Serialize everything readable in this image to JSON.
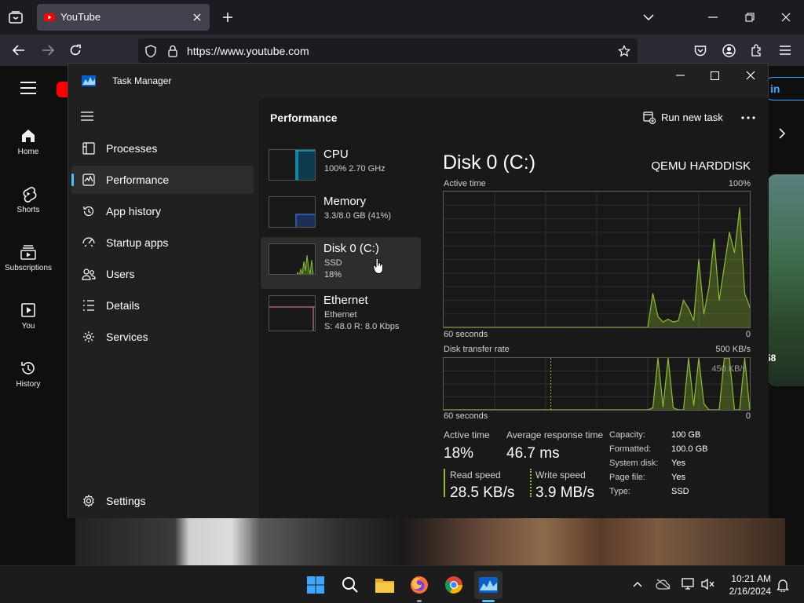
{
  "browser": {
    "tab_title": "YouTube",
    "url": "https://www.youtube.com"
  },
  "youtube": {
    "nav": [
      {
        "label": "Home"
      },
      {
        "label": "Shorts"
      },
      {
        "label": "Subscriptions"
      },
      {
        "label": "You"
      },
      {
        "label": "History"
      }
    ],
    "signin_label": "in",
    "thumb_badge": "58"
  },
  "task_manager": {
    "title": "Task Manager",
    "nav": [
      {
        "label": "Processes",
        "icon": "processes-icon"
      },
      {
        "label": "Performance",
        "icon": "performance-icon",
        "selected": true
      },
      {
        "label": "App history",
        "icon": "app-history-icon"
      },
      {
        "label": "Startup apps",
        "icon": "startup-apps-icon"
      },
      {
        "label": "Users",
        "icon": "users-icon"
      },
      {
        "label": "Details",
        "icon": "details-icon"
      },
      {
        "label": "Services",
        "icon": "services-icon"
      }
    ],
    "settings_label": "Settings",
    "page_title": "Performance",
    "run_new_task_label": "Run new task",
    "resources": [
      {
        "name": "CPU",
        "line1": "100% 2.70 GHz",
        "line2": "",
        "color": "#11a2c3"
      },
      {
        "name": "Memory",
        "line1": "3.3/8.0 GB (41%)",
        "line2": "",
        "color": "#3a68c8"
      },
      {
        "name": "Disk 0 (C:)",
        "line1": "SSD",
        "line2": "18%",
        "color": "#8fbd2e",
        "selected": true
      },
      {
        "name": "Ethernet",
        "line1": "Ethernet",
        "line2": "S: 48.0  R: 8.0 Kbps",
        "color": "#c8708a"
      }
    ],
    "disk": {
      "title": "Disk 0 (C:)",
      "model": "QEMU HARDDISK",
      "active_time_graph": {
        "label": "Active time",
        "max_label": "100%",
        "time_label": "60 seconds",
        "min_label": "0"
      },
      "transfer_graph": {
        "label": "Disk transfer rate",
        "max_label": "500 KB/s",
        "ref_label": "450 KB/s",
        "time_label": "60 seconds",
        "min_label": "0"
      },
      "stats": {
        "active_time_label": "Active time",
        "active_time_value": "18%",
        "avg_response_label": "Average response time",
        "avg_response_value": "46.7 ms",
        "read_speed_label": "Read speed",
        "read_speed_value": "28.5 KB/s",
        "write_speed_label": "Write speed",
        "write_speed_value": "3.9 MB/s"
      },
      "properties": [
        {
          "key": "Capacity:",
          "value": "100 GB"
        },
        {
          "key": "Formatted:",
          "value": "100.0 GB"
        },
        {
          "key": "System disk:",
          "value": "Yes"
        },
        {
          "key": "Page file:",
          "value": "Yes"
        },
        {
          "key": "Type:",
          "value": "SSD"
        }
      ],
      "accent_color": "#8fbd2e"
    }
  },
  "taskbar": {
    "time": "10:21 AM",
    "date": "2/16/2024"
  },
  "chart_data": [
    {
      "type": "area",
      "title": "Active time",
      "xlabel": "60 seconds",
      "ylabel": "",
      "ylim": [
        0,
        100
      ],
      "x": [
        -60,
        -40,
        -39,
        -38,
        -37,
        -36,
        -35,
        -34,
        -33,
        -32,
        -31,
        -30,
        -29,
        -28,
        -27,
        -26,
        -25,
        -24,
        -23,
        -22,
        -21,
        -20,
        -19,
        -18,
        -17,
        -16,
        -15,
        -14,
        -13,
        -12,
        -11,
        -10,
        -9,
        -8,
        -7,
        -6,
        -5,
        -4,
        -3,
        -2,
        -1,
        0
      ],
      "values": [
        0,
        0,
        0,
        0,
        0,
        0,
        0,
        0,
        0,
        0,
        0,
        0,
        0,
        0,
        0,
        0,
        0,
        0,
        0,
        0,
        0,
        0,
        25,
        8,
        4,
        6,
        4,
        5,
        20,
        14,
        5,
        50,
        10,
        30,
        65,
        20,
        45,
        70,
        55,
        88,
        25,
        15
      ]
    },
    {
      "type": "area",
      "title": "Disk transfer rate",
      "xlabel": "60 seconds",
      "ylabel": "",
      "ylim": [
        0,
        500
      ],
      "x": [
        -60,
        -40,
        -39,
        -38,
        -37,
        -36,
        -35,
        -34,
        -33,
        -32,
        -31,
        -30,
        -29,
        -28,
        -27,
        -26,
        -25,
        -24,
        -23,
        -22,
        -21,
        -20,
        -19,
        -18,
        -17,
        -16,
        -15,
        -14,
        -13,
        -12,
        -11,
        -10,
        -9,
        -8,
        -7,
        -6,
        -5,
        -4,
        -3,
        -2,
        -1,
        0
      ],
      "values": [
        0,
        0,
        0,
        0,
        0,
        0,
        0,
        0,
        0,
        0,
        0,
        0,
        0,
        0,
        0,
        0,
        0,
        0,
        0,
        0,
        0,
        0,
        20,
        500,
        30,
        500,
        20,
        0,
        0,
        500,
        40,
        500,
        60,
        0,
        0,
        0,
        500,
        500,
        0,
        0,
        500,
        0
      ]
    }
  ]
}
